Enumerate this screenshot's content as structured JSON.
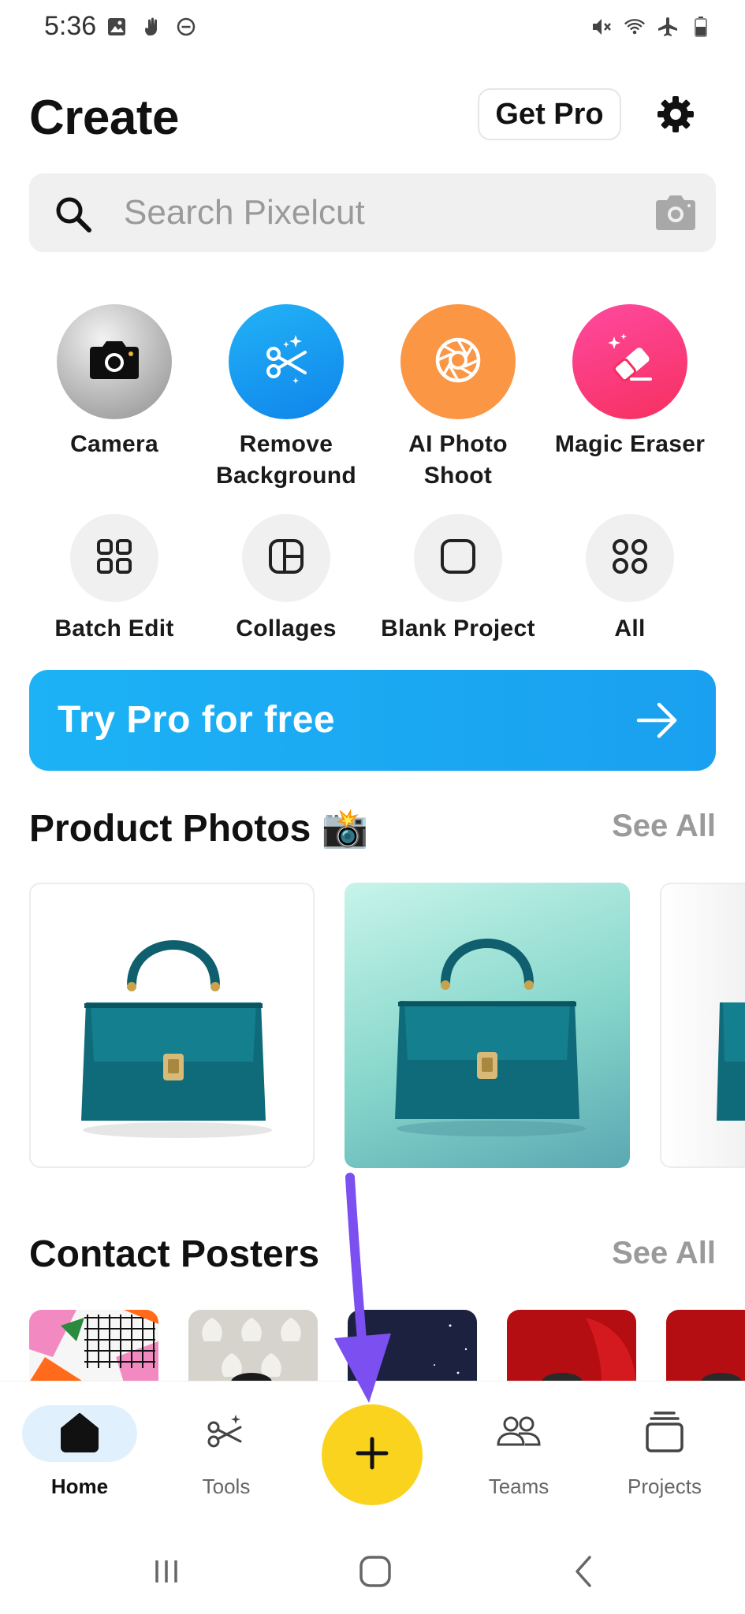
{
  "status_bar": {
    "time": "5:36",
    "left_icons": [
      "gallery-icon",
      "hand-icon",
      "dnd-icon"
    ],
    "right_icons": [
      "mute-icon",
      "wifi-icon",
      "airplane-icon",
      "battery-icon"
    ]
  },
  "header": {
    "title": "Create",
    "get_pro_label": "Get Pro",
    "settings_icon": "gear-icon"
  },
  "search": {
    "placeholder": "Search Pixelcut",
    "icon": "search-icon",
    "camera_icon": "camera-icon"
  },
  "tools_primary": [
    {
      "label": "Camera",
      "icon": "camera-icon",
      "color": "#8e8e8e"
    },
    {
      "label": "Remove Background",
      "icon": "scissors-sparkle-icon",
      "color": "#1a8ff0"
    },
    {
      "label": "AI Photo Shoot",
      "icon": "aperture-icon",
      "color": "#fb9645"
    },
    {
      "label": "Magic Eraser",
      "icon": "eraser-icon",
      "color": "#f93a7a"
    }
  ],
  "tools_secondary": [
    {
      "label": "Batch Edit",
      "icon": "grid-icon"
    },
    {
      "label": "Collages",
      "icon": "collage-icon"
    },
    {
      "label": "Blank Project",
      "icon": "square-icon"
    },
    {
      "label": "All",
      "icon": "apps-icon"
    }
  ],
  "try_pro": {
    "label": "Try Pro for free",
    "icon": "arrow-right-icon",
    "color": "#1cb2f5"
  },
  "product_photos": {
    "title": "Product Photos",
    "emoji": "📸",
    "see_all": "See All"
  },
  "contact_posters": {
    "title": "Contact Posters",
    "see_all": "See All"
  },
  "bottom_nav": {
    "items": [
      {
        "label": "Home",
        "icon": "home-icon",
        "active": true
      },
      {
        "label": "Tools",
        "icon": "scissors-icon",
        "active": false
      },
      {
        "label": "Teams",
        "icon": "people-icon",
        "active": false
      },
      {
        "label": "Projects",
        "icon": "stack-icon",
        "active": false
      }
    ],
    "fab_icon": "plus-icon",
    "fab_color": "#fad31e"
  },
  "system_nav": [
    "recents-icon",
    "home-button-icon",
    "back-icon"
  ],
  "annotation": {
    "icon": "arrow-annotation-icon",
    "color": "#7b4ff0"
  }
}
